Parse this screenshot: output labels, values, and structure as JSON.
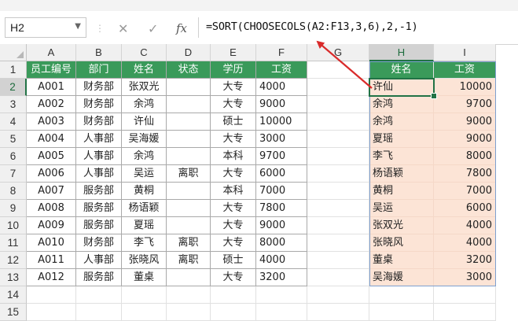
{
  "colors": {
    "header_green": "#3a9a5a",
    "result_fill": "#fce4d6",
    "arrow_red": "#d92b2b"
  },
  "icons": {
    "cancel": "close-icon",
    "enter": "check-icon",
    "function": "fx-icon"
  },
  "formula_bar": {
    "name_box": "H2",
    "formula": "=SORT(CHOOSECOLS(A2:F13,3,6),2,-1)"
  },
  "columns": [
    "A",
    "B",
    "C",
    "D",
    "E",
    "F",
    "G",
    "H",
    "I"
  ],
  "rows": [
    "1",
    "2",
    "3",
    "4",
    "5",
    "6",
    "7",
    "8",
    "9",
    "10",
    "11",
    "12",
    "13",
    "14",
    "15"
  ],
  "source_table": {
    "headers": [
      "员工编号",
      "部门",
      "姓名",
      "状态",
      "学历",
      "工资"
    ],
    "rows": [
      [
        "A001",
        "财务部",
        "张双光",
        "",
        "大专",
        "4000"
      ],
      [
        "A002",
        "财务部",
        "余鸿",
        "",
        "大专",
        "9000"
      ],
      [
        "A003",
        "财务部",
        "许仙",
        "",
        "硕士",
        "10000"
      ],
      [
        "A004",
        "人事部",
        "吴海媛",
        "",
        "大专",
        "3000"
      ],
      [
        "A005",
        "人事部",
        "余鸿",
        "",
        "本科",
        "9700"
      ],
      [
        "A006",
        "人事部",
        "吴运",
        "离职",
        "大专",
        "6000"
      ],
      [
        "A007",
        "服务部",
        "黄桐",
        "",
        "本科",
        "7000"
      ],
      [
        "A008",
        "服务部",
        "杨语颖",
        "",
        "大专",
        "7800"
      ],
      [
        "A009",
        "服务部",
        "夏瑶",
        "",
        "大专",
        "9000"
      ],
      [
        "A010",
        "财务部",
        "李飞",
        "离职",
        "大专",
        "8000"
      ],
      [
        "A011",
        "人事部",
        "张晓风",
        "离职",
        "硕士",
        "4000"
      ],
      [
        "A012",
        "服务部",
        "董桌",
        "",
        "大专",
        "3200"
      ]
    ]
  },
  "result_table": {
    "headers": [
      "姓名",
      "工资"
    ],
    "rows": [
      [
        "许仙",
        "10000"
      ],
      [
        "余鸿",
        "9700"
      ],
      [
        "余鸿",
        "9000"
      ],
      [
        "夏瑶",
        "9000"
      ],
      [
        "李飞",
        "8000"
      ],
      [
        "杨语颖",
        "7800"
      ],
      [
        "黄桐",
        "7000"
      ],
      [
        "吴运",
        "6000"
      ],
      [
        "张双光",
        "4000"
      ],
      [
        "张晓风",
        "4000"
      ],
      [
        "董桌",
        "3200"
      ],
      [
        "吴海媛",
        "3000"
      ]
    ]
  }
}
